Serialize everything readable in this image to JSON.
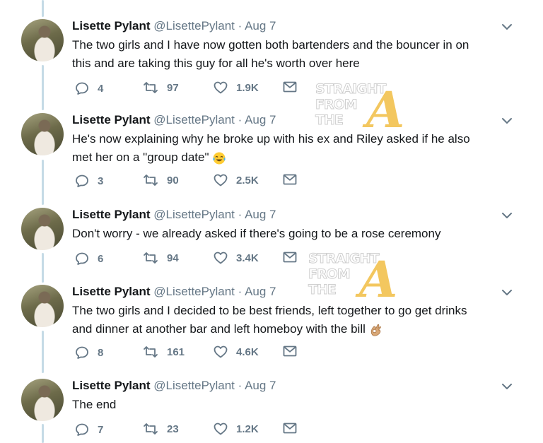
{
  "colors": {
    "thread_line": "#c5dbe6",
    "secondary": "#657786",
    "watermark_gold": "#f2c14e"
  },
  "tweets": [
    {
      "name": "Lisette Pylant",
      "handle": "@LisettePylant",
      "sep": "·",
      "date": "Aug 7",
      "lines": [
        "The two girls and I have now gotten both bartenders and the bouncer in on",
        "this and are taking this guy for all he's worth over here"
      ],
      "emoji": "",
      "replies": "4",
      "retweets": "97",
      "likes": "1.9K"
    },
    {
      "name": "Lisette Pylant",
      "handle": "@LisettePylant",
      "sep": "·",
      "date": "Aug 7",
      "lines": [
        "He's now explaining why he broke up with his ex and Riley asked if he also",
        "met her on a \"group date\""
      ],
      "emoji": "tears-of-joy",
      "replies": "3",
      "retweets": "90",
      "likes": "2.5K"
    },
    {
      "name": "Lisette Pylant",
      "handle": "@LisettePylant",
      "sep": "·",
      "date": "Aug 7",
      "lines": [
        "Don't worry - we already asked if there's going to be a rose ceremony"
      ],
      "emoji": "",
      "replies": "6",
      "retweets": "94",
      "likes": "3.4K"
    },
    {
      "name": "Lisette Pylant",
      "handle": "@LisettePylant",
      "sep": "·",
      "date": "Aug 7",
      "lines": [
        "The two girls and I decided to be best friends, left together to go get drinks",
        "and dinner at another bar and left homeboy with the bill"
      ],
      "emoji": "ok-hand",
      "replies": "8",
      "retweets": "161",
      "likes": "4.6K"
    },
    {
      "name": "Lisette Pylant",
      "handle": "@LisettePylant",
      "sep": "·",
      "date": "Aug 7",
      "lines": [
        "The end"
      ],
      "emoji": "",
      "replies": "7",
      "retweets": "23",
      "likes": "1.2K"
    }
  ],
  "watermark": {
    "line1": "STRAIGHT",
    "line2": "FROM",
    "line3": "THE",
    "letter": "A"
  }
}
